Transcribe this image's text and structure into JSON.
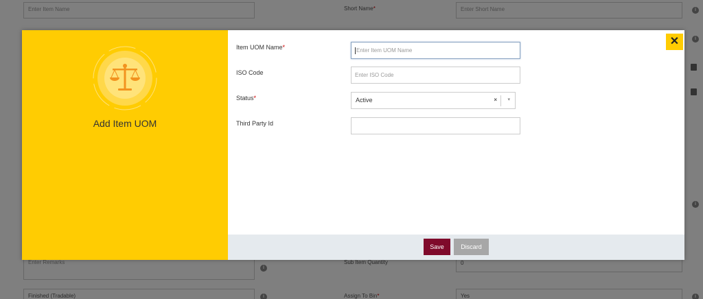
{
  "background": {
    "item_name_placeholder": "Enter Item Name",
    "short_name_label": "Short Name",
    "short_name_placeholder": "Enter Short Name",
    "remarks_placeholder": "Enter Remarks",
    "sub_item_quantity_label": "Sub Item Quantity",
    "sub_item_quantity_value": "0",
    "item_type_value": "Finished (Tradable)",
    "assign_to_bin_label": "Assign To Bin",
    "assign_to_bin_value": "Yes",
    "info_icon_glyph": "i"
  },
  "modal": {
    "title": "Add Item UOM",
    "emblem_icon": "scale-balance-icon",
    "close_glyph": "✕",
    "fields": {
      "uom_name": {
        "label": "Item UOM Name",
        "placeholder": "Enter Item UOM Name"
      },
      "iso_code": {
        "label": "ISO Code",
        "placeholder": "Enter ISO Code"
      },
      "status": {
        "label": "Status",
        "value": "Active",
        "clear_glyph": "×",
        "caret_glyph": "▾"
      },
      "third_party_id": {
        "label": "Third Party Id",
        "value": ""
      }
    },
    "required_mark": "*",
    "footer": {
      "save_label": "Save",
      "discard_label": "Discard"
    }
  },
  "colors": {
    "accent_yellow": "#ffcc02",
    "save_button": "#7f0a2b",
    "discard_button": "#a7a7a7",
    "footer_bg": "#e5eaee",
    "required": "#cc0000"
  }
}
